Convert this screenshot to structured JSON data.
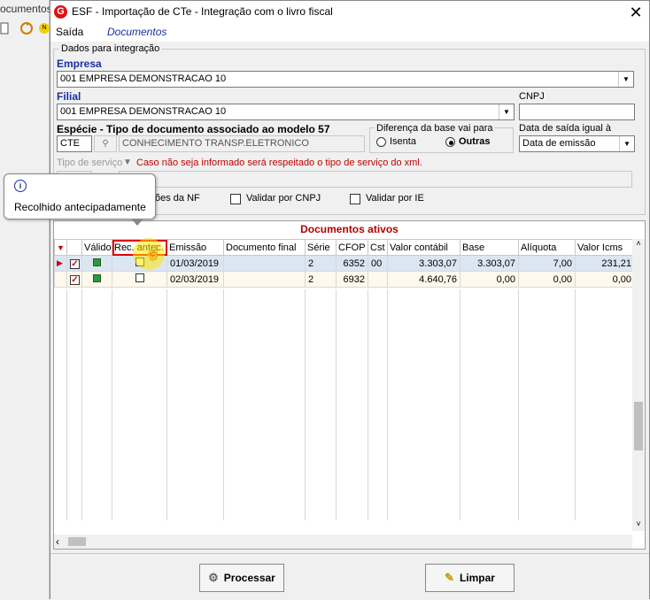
{
  "background": {
    "partial_text": "ocumentos"
  },
  "window": {
    "title": "ESF - Importação de CTe - Integração com o livro fiscal",
    "close_glyph": "✕"
  },
  "menu": {
    "items": [
      "Saída",
      "Documentos"
    ]
  },
  "integration": {
    "group_title": "Dados para integração",
    "empresa_label": "Empresa",
    "empresa_value": "001 EMPRESA DEMONSTRACAO 10",
    "filial_label": "Filial",
    "filial_value": "001 EMPRESA DEMONSTRACAO 10",
    "cnpj_label": "CNPJ",
    "cnpj_value": "",
    "especie_label": "Espécie - Tipo de documento associado ao modelo 57",
    "especie_code": "CTE",
    "especie_desc": "CONHECIMENTO TRANSP.ELETRONICO",
    "diferenca_title": "Diferença da base vai para",
    "radio_isenta": "Isenta",
    "radio_outras": "Outras",
    "data_saida_label": "Data de saída igual à",
    "data_saida_value": "Data de emissão",
    "tipo_servico_label": "Tipo de serviço",
    "tipo_servico_warning": "Caso não seja informado será respeitado o tipo de serviço do xml.",
    "chk_nf_label": "ões da NF",
    "chk_cnpj_label": "Validar por CNPJ",
    "chk_ie_label": "Validar por IE"
  },
  "tooltip": {
    "text": "Recolhido antecipadamente"
  },
  "grid": {
    "title": "Documentos ativos",
    "columns": [
      "Válido",
      "Rec. antec.",
      "Emissão",
      "Documento final",
      "Série",
      "CFOP",
      "Cst",
      "Valor contábil",
      "Base",
      "Alíquota",
      "Valor Icms"
    ],
    "rows": [
      {
        "emissao": "01/03/2019",
        "doc_final": "",
        "serie": "2",
        "cfop": "6352",
        "cst": "00",
        "valor_contabil": "3.303,07",
        "base": "3.303,07",
        "aliquota": "7,00",
        "valor_icms": "231,21"
      },
      {
        "emissao": "02/03/2019",
        "doc_final": "",
        "serie": "2",
        "cfop": "6932",
        "cst": "",
        "valor_contabil": "4.640,76",
        "base": "0,00",
        "aliquota": "0,00",
        "valor_icms": "0,00"
      }
    ]
  },
  "buttons": {
    "processar": "Processar",
    "limpar": "Limpar"
  },
  "colors": {
    "accent_blue": "#1a2fa0",
    "grid_title_red": "#b40000",
    "highlight_red": "#e00000",
    "selected_row": "#dce6f2"
  }
}
